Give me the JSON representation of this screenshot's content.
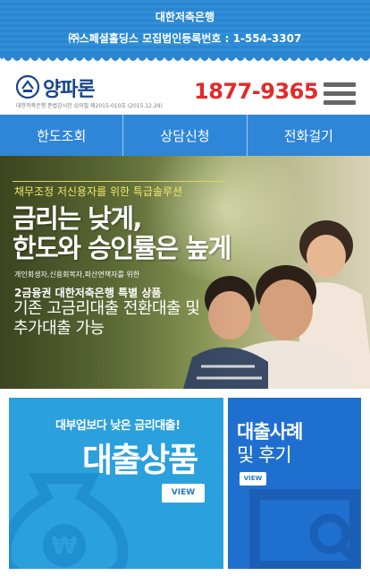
{
  "topbar": {
    "bank_name": "대한저축은행",
    "registration": "㈜스페셜홀딩스 모집법인등록번호 : 1-554-3307"
  },
  "header": {
    "logo_text": "양파론",
    "logo_sub": "대한저축은행 준법감시인 심의필 제2015-010호 (2015.12.29)",
    "phone": "1877-9365",
    "menu_icon": "hamburger-menu-icon"
  },
  "nav": {
    "items": [
      {
        "label": "한도조회"
      },
      {
        "label": "상담신청"
      },
      {
        "label": "전화걸기"
      }
    ]
  },
  "hero": {
    "tag": "채무조정 저신용자를 위한 특급솔루션",
    "headline_1": "금리는 낮게,",
    "headline_2": "한도와 승인률은 높게",
    "small_text": "개인회생자,신용회복자,파산면책자를 위한",
    "sub_text": "2금융권 대한저축은행 특별 상품",
    "big_1": "기존 고금리대출 전환대출 및",
    "big_2": "추가대출 가능"
  },
  "cards": {
    "product": {
      "small": "대부업보다 낮은 금리대출!",
      "big": "대출상품",
      "view": "VIEW",
      "icon": "money-bag-icon"
    },
    "reviews": {
      "title_1": "대출사례",
      "title_2": "및 후기",
      "view": "VIEW",
      "icon": "search-document-icon"
    }
  },
  "colors": {
    "topbar": "#2f8fd9",
    "nav": "#2f86d8",
    "phone": "#e02b2b",
    "logo": "#17458a",
    "card_product": "#2aa0dd",
    "card_reviews": "#1f6fcf",
    "hero_tag": "#f3e86b"
  }
}
